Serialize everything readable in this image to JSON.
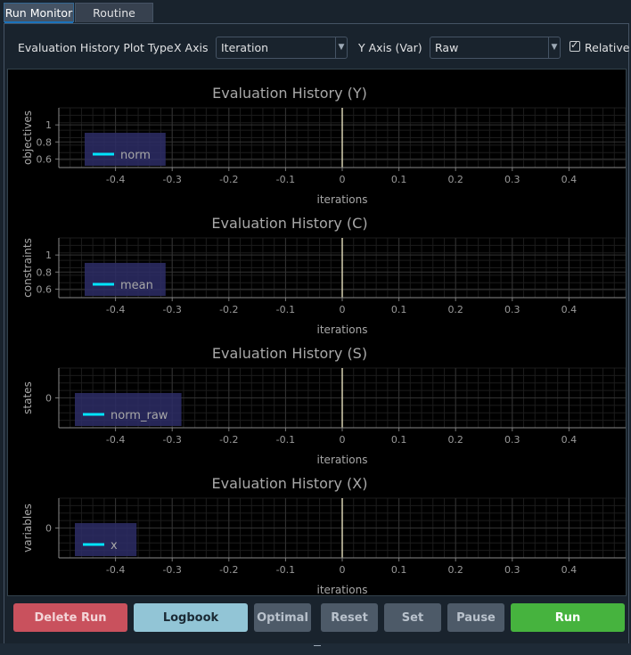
{
  "tabs": [
    {
      "label": "Run Monitor",
      "active": true
    },
    {
      "label": "Routine Editor",
      "active": false
    }
  ],
  "toolbar": {
    "plot_type_label": "Evaluation History Plot Type",
    "x_axis_label": "X Axis",
    "x_axis_value": "Iteration",
    "y_axis_label": "Y Axis (Var)",
    "y_axis_value": "Raw",
    "relative_label": "Relative",
    "relative_checked": true
  },
  "buttons": {
    "delete_run": "Delete Run",
    "logbook": "Logbook",
    "optimal": "Optimal",
    "reset": "Reset",
    "set": "Set",
    "pause": "Pause",
    "run": "Run"
  },
  "colors": {
    "delete_run": "#c9515d",
    "logbook": "#92c5d6",
    "optimal": "#4d5a68",
    "reset": "#4d5a68",
    "set": "#4d5a68",
    "pause": "#4d5a68",
    "run": "#46b33e",
    "series": "#00e5ff"
  },
  "chart_data": [
    {
      "type": "line",
      "title": "Evaluation History (Y)",
      "xlabel": "iterations",
      "ylabel": "objectives",
      "x_ticks": [
        "-0.4",
        "-0.3",
        "-0.2",
        "-0.1",
        "0",
        "0.1",
        "0.2",
        "0.3",
        "0.4"
      ],
      "y_ticks": [
        "0.6",
        "0.8",
        "1"
      ],
      "xlim": [
        -0.5,
        0.5
      ],
      "ylim": [
        0.5,
        1.2
      ],
      "grid": true,
      "legend_position": "bottom-left",
      "series": [
        {
          "name": "norm",
          "x": [],
          "y": []
        }
      ]
    },
    {
      "type": "line",
      "title": "Evaluation History (C)",
      "xlabel": "iterations",
      "ylabel": "constraints",
      "x_ticks": [
        "-0.4",
        "-0.3",
        "-0.2",
        "-0.1",
        "0",
        "0.1",
        "0.2",
        "0.3",
        "0.4"
      ],
      "y_ticks": [
        "0.6",
        "0.8",
        "1"
      ],
      "xlim": [
        -0.5,
        0.5
      ],
      "ylim": [
        0.5,
        1.2
      ],
      "grid": true,
      "legend_position": "bottom-left",
      "series": [
        {
          "name": "mean",
          "x": [],
          "y": []
        }
      ]
    },
    {
      "type": "line",
      "title": "Evaluation History (S)",
      "xlabel": "iterations",
      "ylabel": "states",
      "x_ticks": [
        "-0.4",
        "-0.3",
        "-0.2",
        "-0.1",
        "0",
        "0.1",
        "0.2",
        "0.3",
        "0.4"
      ],
      "y_ticks": [
        "0"
      ],
      "xlim": [
        -0.5,
        0.5
      ],
      "ylim": [
        -1,
        1
      ],
      "grid": true,
      "legend_position": "bottom-left",
      "series": [
        {
          "name": "norm_raw",
          "x": [],
          "y": []
        }
      ]
    },
    {
      "type": "line",
      "title": "Evaluation History (X)",
      "xlabel": "iterations",
      "ylabel": "variables",
      "x_ticks": [
        "-0.4",
        "-0.3",
        "-0.2",
        "-0.1",
        "0",
        "0.1",
        "0.2",
        "0.3",
        "0.4"
      ],
      "y_ticks": [
        "0"
      ],
      "xlim": [
        -0.5,
        0.5
      ],
      "ylim": [
        -1,
        1
      ],
      "grid": true,
      "legend_position": "bottom-left",
      "series": [
        {
          "name": "x",
          "x": [],
          "y": []
        }
      ]
    }
  ]
}
